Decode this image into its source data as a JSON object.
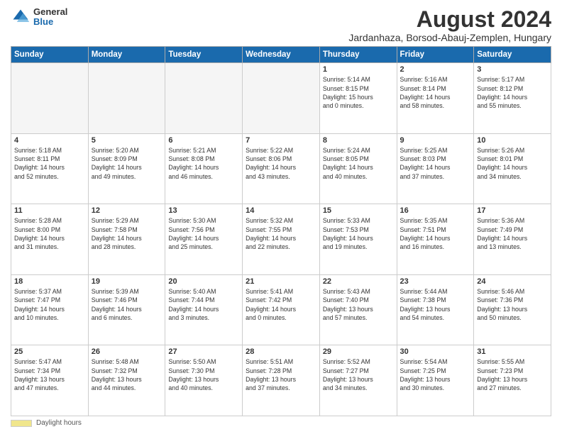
{
  "logo": {
    "general": "General",
    "blue": "Blue"
  },
  "title": "August 2024",
  "subtitle": "Jardanhaza, Borsod-Abauj-Zemplen, Hungary",
  "columns": [
    "Sunday",
    "Monday",
    "Tuesday",
    "Wednesday",
    "Thursday",
    "Friday",
    "Saturday"
  ],
  "footer": {
    "bar_label": "Daylight hours"
  },
  "days": [
    {
      "num": "",
      "info": ""
    },
    {
      "num": "",
      "info": ""
    },
    {
      "num": "",
      "info": ""
    },
    {
      "num": "",
      "info": ""
    },
    {
      "num": "1",
      "info": "Sunrise: 5:14 AM\nSunset: 8:15 PM\nDaylight: 15 hours\nand 0 minutes."
    },
    {
      "num": "2",
      "info": "Sunrise: 5:16 AM\nSunset: 8:14 PM\nDaylight: 14 hours\nand 58 minutes."
    },
    {
      "num": "3",
      "info": "Sunrise: 5:17 AM\nSunset: 8:12 PM\nDaylight: 14 hours\nand 55 minutes."
    },
    {
      "num": "4",
      "info": "Sunrise: 5:18 AM\nSunset: 8:11 PM\nDaylight: 14 hours\nand 52 minutes."
    },
    {
      "num": "5",
      "info": "Sunrise: 5:20 AM\nSunset: 8:09 PM\nDaylight: 14 hours\nand 49 minutes."
    },
    {
      "num": "6",
      "info": "Sunrise: 5:21 AM\nSunset: 8:08 PM\nDaylight: 14 hours\nand 46 minutes."
    },
    {
      "num": "7",
      "info": "Sunrise: 5:22 AM\nSunset: 8:06 PM\nDaylight: 14 hours\nand 43 minutes."
    },
    {
      "num": "8",
      "info": "Sunrise: 5:24 AM\nSunset: 8:05 PM\nDaylight: 14 hours\nand 40 minutes."
    },
    {
      "num": "9",
      "info": "Sunrise: 5:25 AM\nSunset: 8:03 PM\nDaylight: 14 hours\nand 37 minutes."
    },
    {
      "num": "10",
      "info": "Sunrise: 5:26 AM\nSunset: 8:01 PM\nDaylight: 14 hours\nand 34 minutes."
    },
    {
      "num": "11",
      "info": "Sunrise: 5:28 AM\nSunset: 8:00 PM\nDaylight: 14 hours\nand 31 minutes."
    },
    {
      "num": "12",
      "info": "Sunrise: 5:29 AM\nSunset: 7:58 PM\nDaylight: 14 hours\nand 28 minutes."
    },
    {
      "num": "13",
      "info": "Sunrise: 5:30 AM\nSunset: 7:56 PM\nDaylight: 14 hours\nand 25 minutes."
    },
    {
      "num": "14",
      "info": "Sunrise: 5:32 AM\nSunset: 7:55 PM\nDaylight: 14 hours\nand 22 minutes."
    },
    {
      "num": "15",
      "info": "Sunrise: 5:33 AM\nSunset: 7:53 PM\nDaylight: 14 hours\nand 19 minutes."
    },
    {
      "num": "16",
      "info": "Sunrise: 5:35 AM\nSunset: 7:51 PM\nDaylight: 14 hours\nand 16 minutes."
    },
    {
      "num": "17",
      "info": "Sunrise: 5:36 AM\nSunset: 7:49 PM\nDaylight: 14 hours\nand 13 minutes."
    },
    {
      "num": "18",
      "info": "Sunrise: 5:37 AM\nSunset: 7:47 PM\nDaylight: 14 hours\nand 10 minutes."
    },
    {
      "num": "19",
      "info": "Sunrise: 5:39 AM\nSunset: 7:46 PM\nDaylight: 14 hours\nand 6 minutes."
    },
    {
      "num": "20",
      "info": "Sunrise: 5:40 AM\nSunset: 7:44 PM\nDaylight: 14 hours\nand 3 minutes."
    },
    {
      "num": "21",
      "info": "Sunrise: 5:41 AM\nSunset: 7:42 PM\nDaylight: 14 hours\nand 0 minutes."
    },
    {
      "num": "22",
      "info": "Sunrise: 5:43 AM\nSunset: 7:40 PM\nDaylight: 13 hours\nand 57 minutes."
    },
    {
      "num": "23",
      "info": "Sunrise: 5:44 AM\nSunset: 7:38 PM\nDaylight: 13 hours\nand 54 minutes."
    },
    {
      "num": "24",
      "info": "Sunrise: 5:46 AM\nSunset: 7:36 PM\nDaylight: 13 hours\nand 50 minutes."
    },
    {
      "num": "25",
      "info": "Sunrise: 5:47 AM\nSunset: 7:34 PM\nDaylight: 13 hours\nand 47 minutes."
    },
    {
      "num": "26",
      "info": "Sunrise: 5:48 AM\nSunset: 7:32 PM\nDaylight: 13 hours\nand 44 minutes."
    },
    {
      "num": "27",
      "info": "Sunrise: 5:50 AM\nSunset: 7:30 PM\nDaylight: 13 hours\nand 40 minutes."
    },
    {
      "num": "28",
      "info": "Sunrise: 5:51 AM\nSunset: 7:28 PM\nDaylight: 13 hours\nand 37 minutes."
    },
    {
      "num": "29",
      "info": "Sunrise: 5:52 AM\nSunset: 7:27 PM\nDaylight: 13 hours\nand 34 minutes."
    },
    {
      "num": "30",
      "info": "Sunrise: 5:54 AM\nSunset: 7:25 PM\nDaylight: 13 hours\nand 30 minutes."
    },
    {
      "num": "31",
      "info": "Sunrise: 5:55 AM\nSunset: 7:23 PM\nDaylight: 13 hours\nand 27 minutes."
    },
    {
      "num": "",
      "info": ""
    },
    {
      "num": "",
      "info": ""
    },
    {
      "num": "",
      "info": ""
    },
    {
      "num": "",
      "info": ""
    },
    {
      "num": "",
      "info": ""
    },
    {
      "num": "",
      "info": ""
    },
    {
      "num": "",
      "info": ""
    }
  ]
}
